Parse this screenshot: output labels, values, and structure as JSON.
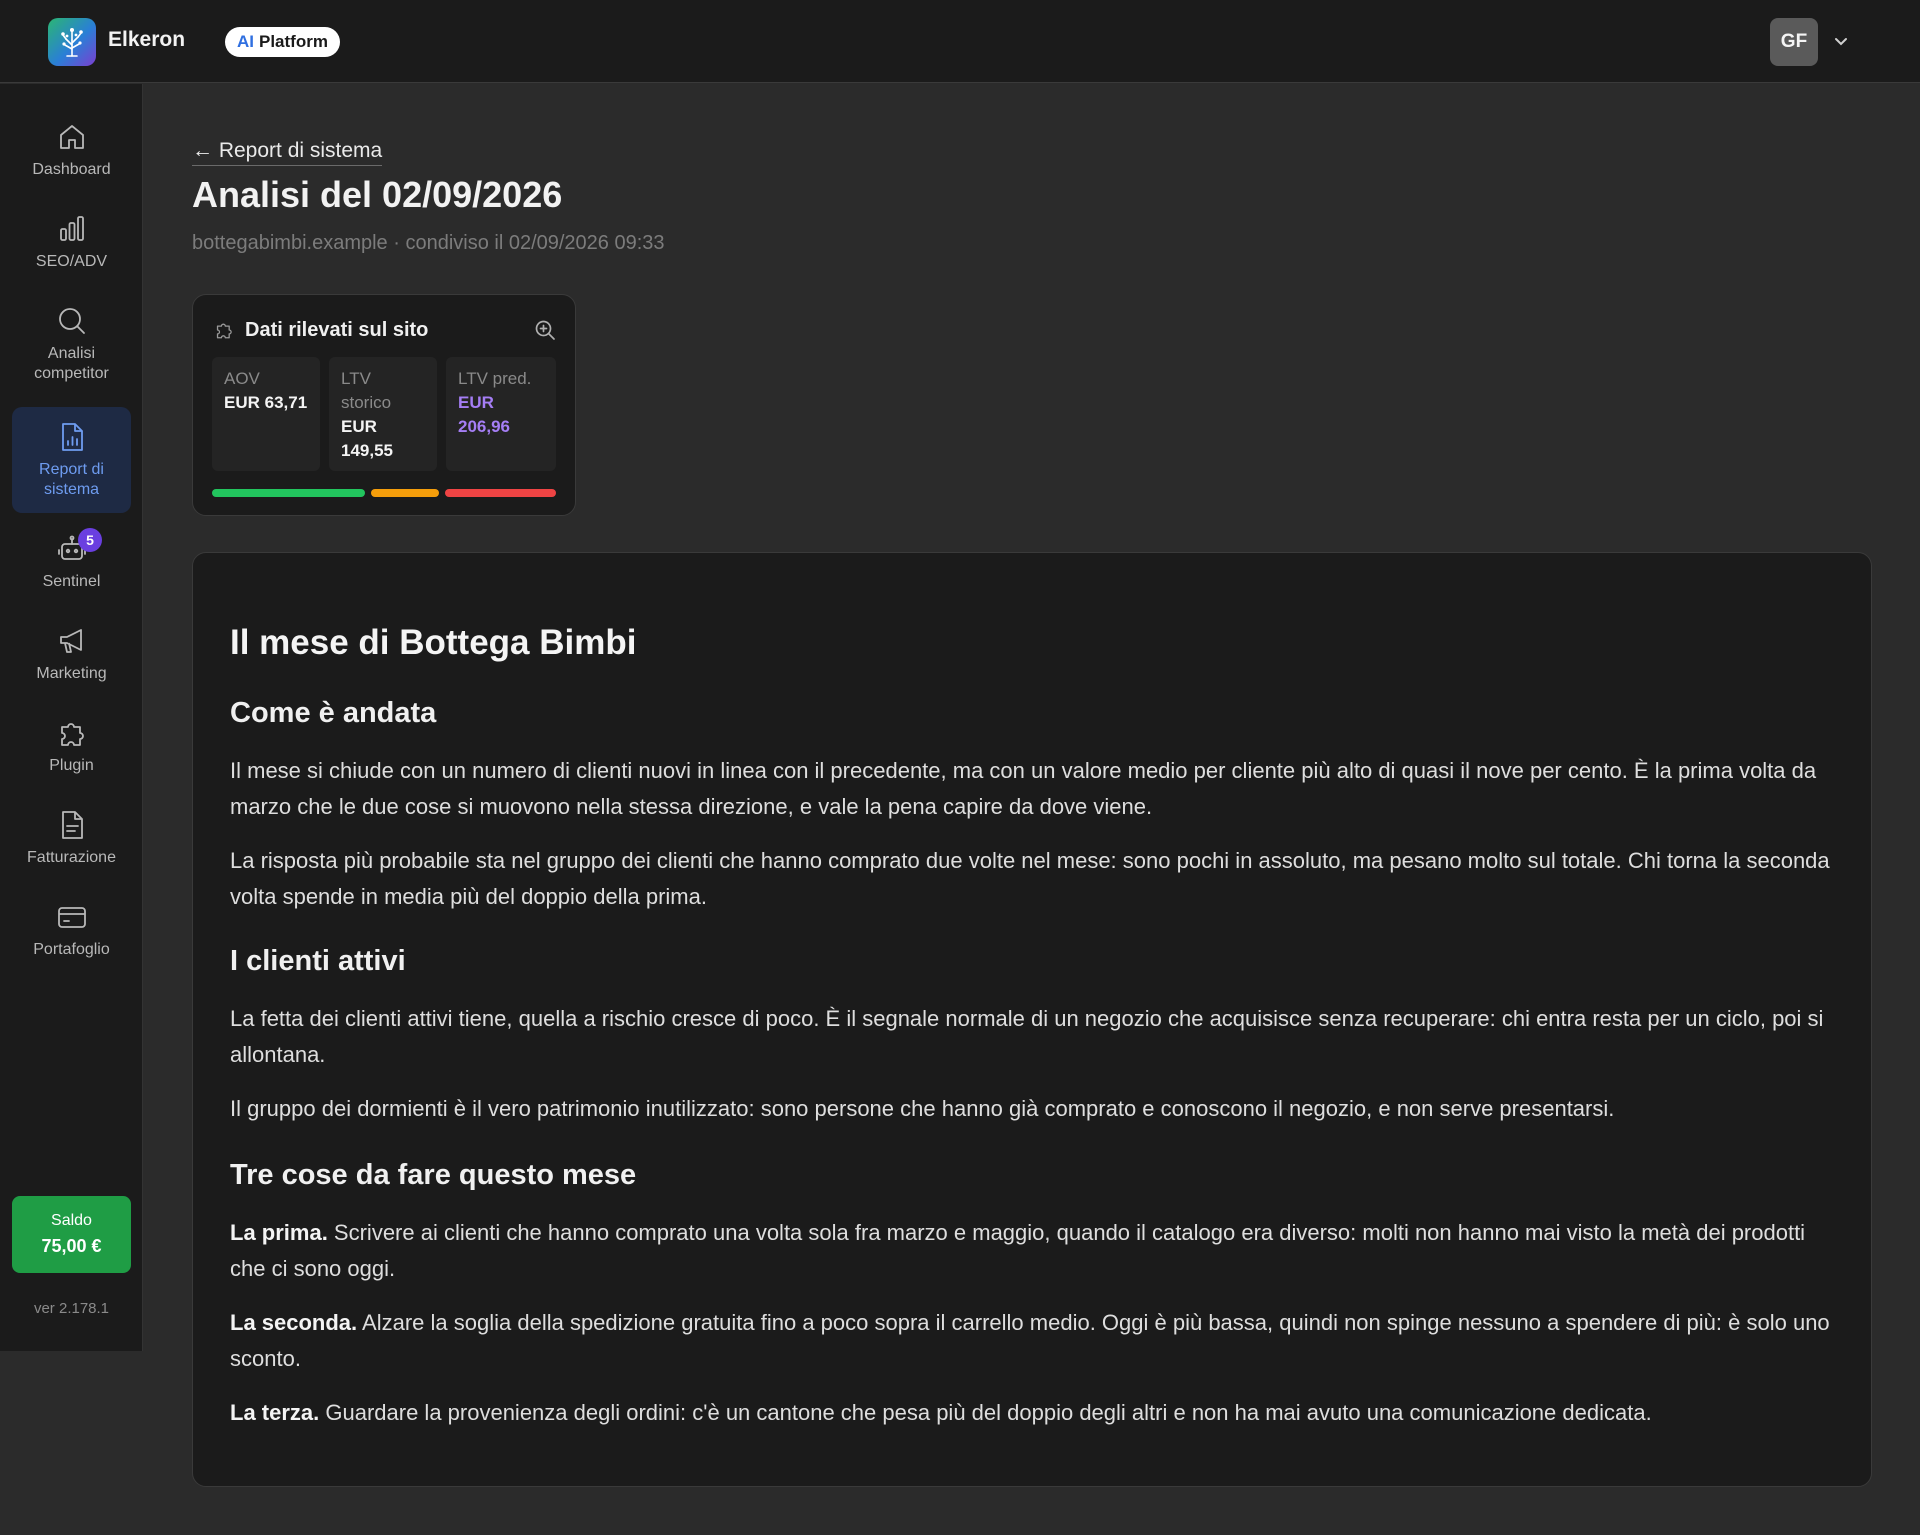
{
  "header": {
    "brand": "Elkeron",
    "platform_ai": "AI",
    "platform_label": "Platform",
    "user_initials": "GF"
  },
  "sidebar": {
    "items": [
      {
        "label": "Dashboard",
        "icon": "home-icon"
      },
      {
        "label": "SEO/ADV",
        "icon": "bar-chart-icon"
      },
      {
        "label": "Analisi competitor",
        "icon": "search-icon"
      },
      {
        "label": "Report di sistema",
        "icon": "report-icon",
        "active": true
      },
      {
        "label": "Sentinel",
        "icon": "robot-icon",
        "badge": "5"
      },
      {
        "label": "Marketing",
        "icon": "megaphone-icon"
      },
      {
        "label": "Plugin",
        "icon": "puzzle-icon"
      },
      {
        "label": "Fatturazione",
        "icon": "invoice-icon"
      },
      {
        "label": "Portafoglio",
        "icon": "wallet-icon"
      }
    ],
    "saldo_label": "Saldo",
    "saldo_amount": "75,00 €",
    "version": "ver 2.178.1"
  },
  "main": {
    "back_link": "← Report di sistema",
    "title": "Analisi del 02/09/2026",
    "subtitle": "bottegabimbi.example · condiviso il 02/09/2026 09:33",
    "card": {
      "title": "Dati rilevati sul sito",
      "metrics": [
        {
          "label": "AOV",
          "value": "EUR 63,71"
        },
        {
          "label": "LTV storico",
          "value": "EUR 149,55"
        },
        {
          "label": "LTV pred.",
          "value": "EUR 206,96"
        }
      ],
      "bar_colors": [
        "#22c55e",
        "#f59e0b",
        "#ef4444"
      ]
    },
    "report": {
      "h1": "Il mese di Bottega Bimbi",
      "s1_title": "Come è andata",
      "s1_p1": "Il mese si chiude con un numero di clienti nuovi in linea con il precedente, ma con un valore medio per cliente più alto di quasi il nove per cento. È la prima volta da marzo che le due cose si muovono nella stessa direzione, e vale la pena capire da dove viene.",
      "s1_p2": "La risposta più probabile sta nel gruppo dei clienti che hanno comprato due volte nel mese: sono pochi in assoluto, ma pesano molto sul totale. Chi torna la seconda volta spende in media più del doppio della prima.",
      "s2_title": "I clienti attivi",
      "s2_p1": "La fetta dei clienti attivi tiene, quella a rischio cresce di poco. È il segnale normale di un negozio che acquisisce senza recuperare: chi entra resta per un ciclo, poi si allontana.",
      "s2_p2": "Il gruppo dei dormienti è il vero patrimonio inutilizzato: sono persone che hanno già comprato e conoscono il negozio, e non serve presentarsi.",
      "s3_title": "Tre cose da fare questo mese",
      "a1_lead": "La prima.",
      "a1_text": " Scrivere ai clienti che hanno comprato una volta sola fra marzo e maggio, quando il catalogo era diverso: molti non hanno mai visto la metà dei prodotti che ci sono oggi.",
      "a2_lead": "La seconda.",
      "a2_text": " Alzare la soglia della spedizione gratuita fino a poco sopra il carrello medio. Oggi è più bassa, quindi non spinge nessuno a spendere di più: è solo uno sconto.",
      "a3_lead": "La terza.",
      "a3_text": " Guardare la provenienza degli ordini: c'è un cantone che pesa più del doppio degli altri e non ha mai avuto una comunicazione dedicata."
    }
  }
}
